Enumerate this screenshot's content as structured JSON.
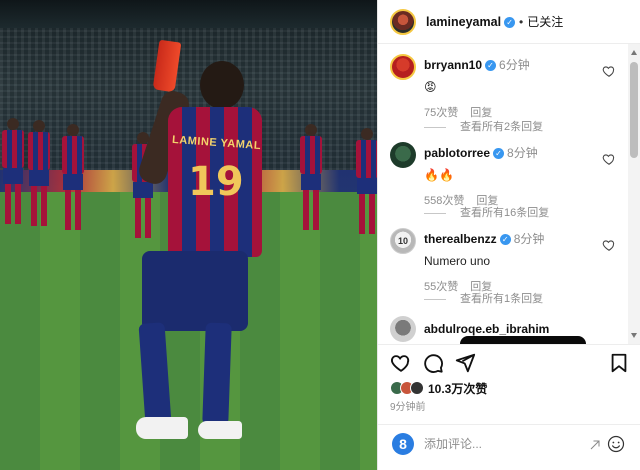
{
  "photo": {
    "shirt_name": "LAMINE YAMAL",
    "shirt_number": "19"
  },
  "header": {
    "username": "lamineyamal",
    "separator": "•",
    "follow_status": "已关注"
  },
  "comments": [
    {
      "username": "brryann10",
      "time": "6分钟",
      "text": "😡",
      "likes": "75次赞",
      "reply_label": "回复",
      "view_replies": "查看所有2条回复"
    },
    {
      "username": "pablotorree",
      "time": "8分钟",
      "text": "🔥🔥",
      "likes": "558次赞",
      "reply_label": "回复",
      "view_replies": "查看所有16条回复"
    },
    {
      "username": "therealbenzz",
      "time": "8分钟",
      "text": "Numero uno",
      "likes": "55次赞",
      "reply_label": "回复",
      "view_replies": "查看所有1条回复"
    },
    {
      "username": "abdulroqe.eb_ibrahim"
    }
  ],
  "actions": {
    "like_icon": "heart-icon",
    "comment_icon": "comment-icon",
    "share_icon": "send-icon",
    "save_icon": "bookmark-icon"
  },
  "likes": {
    "count_text": "10.3万次赞"
  },
  "post_time": "9分钟前",
  "comment_input": {
    "placeholder": "添加评论..."
  },
  "colors": {
    "verified_blue": "#3897f0",
    "muted_gray": "#8e8e8e",
    "user_badge_blue": "#2a7de1"
  }
}
